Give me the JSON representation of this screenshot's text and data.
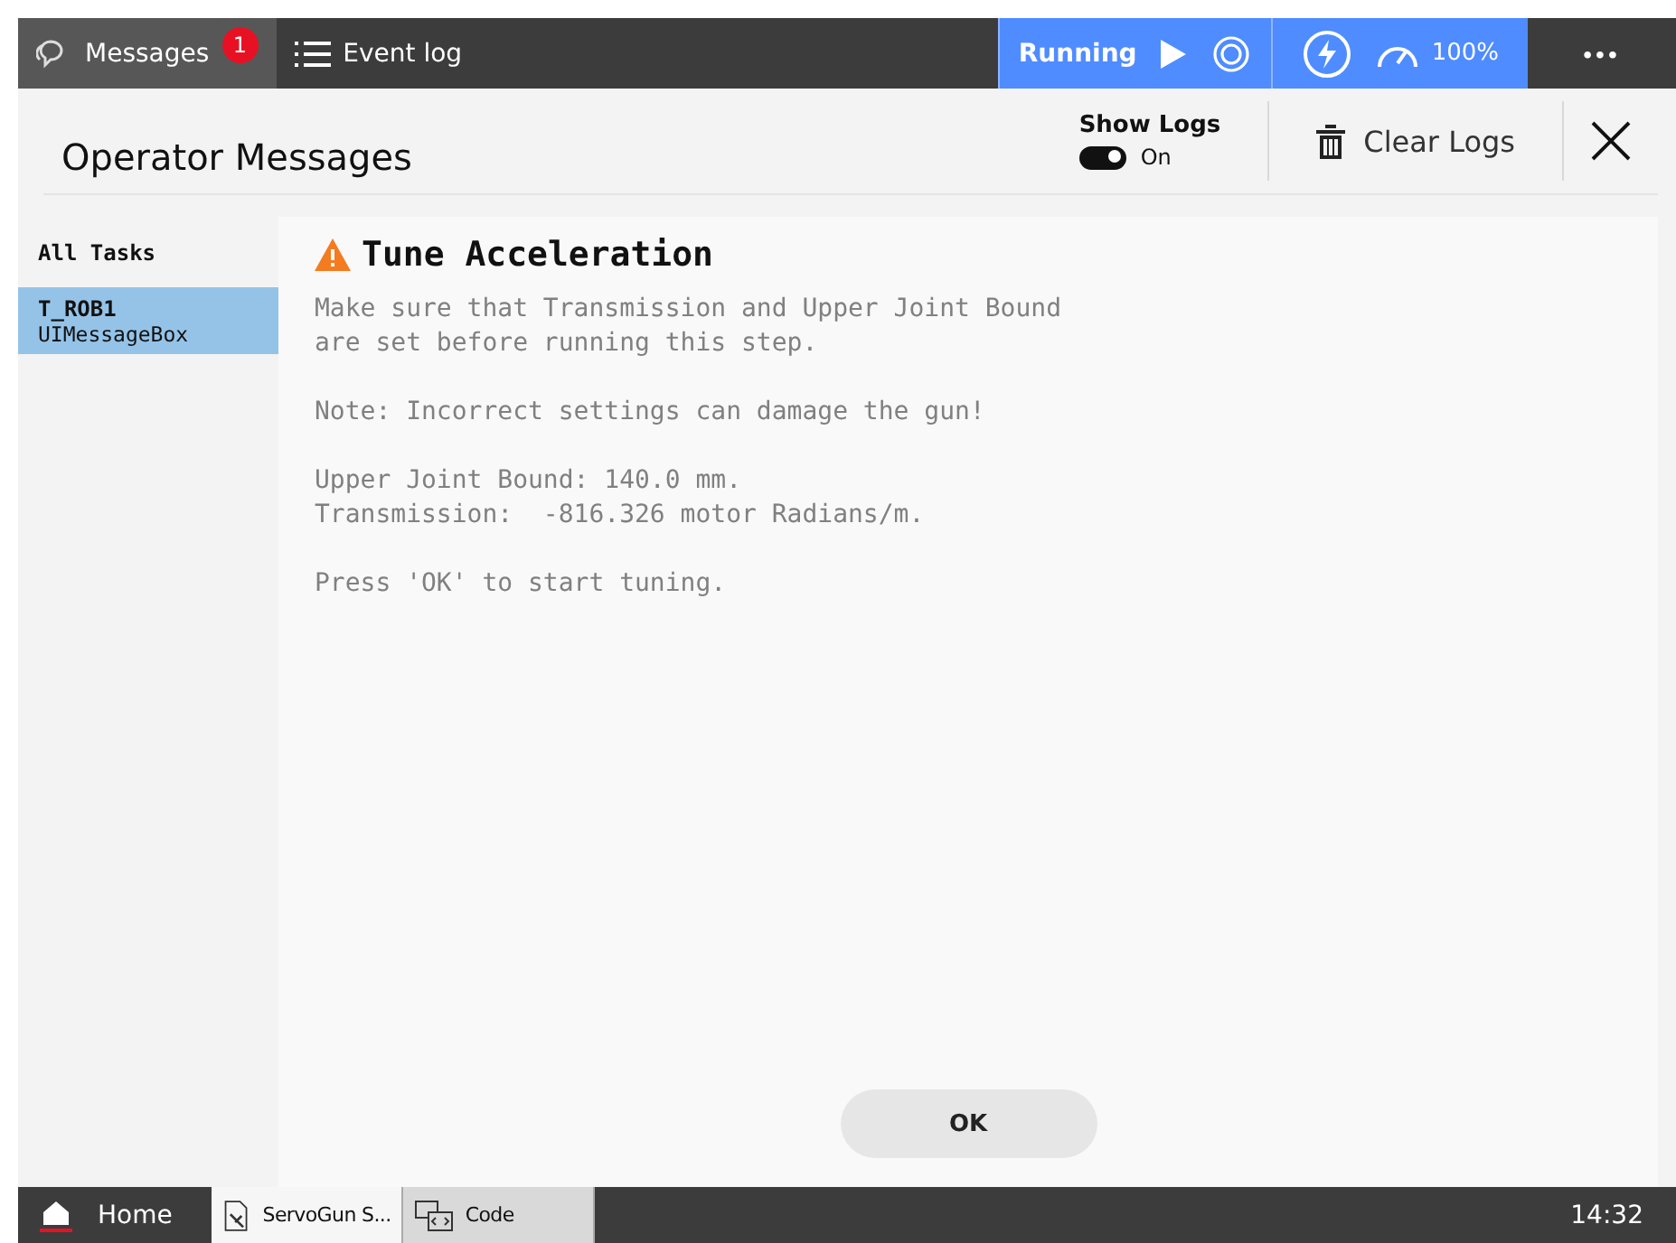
{
  "top_bar": {
    "tabs": [
      {
        "label": "Messages",
        "badge": "1",
        "selected": true,
        "kind": "chat"
      },
      {
        "label": "Event log",
        "selected": false,
        "kind": "list"
      }
    ],
    "status": {
      "state": "Running",
      "speed": "100%"
    },
    "more": "•••"
  },
  "header": {
    "title": "Operator Messages",
    "show_logs": {
      "label": "Show Logs",
      "on": true,
      "state_text": "On"
    },
    "clear_logs": "Clear Logs"
  },
  "sidebar": {
    "heading": "All Tasks",
    "items": [
      {
        "task": "T_ROB1",
        "module": "UIMessageBox",
        "selected": true
      }
    ]
  },
  "message": {
    "title": "Tune Acceleration",
    "paragraphs": [
      "Make sure that Transmission and Upper Joint Bound\nare set before running this step.",
      "Note: Incorrect settings can damage the gun!",
      "Upper Joint Bound: 140.0 mm.\nTransmission:  -816.326 motor Radians/m.",
      "Press 'OK' to start tuning."
    ],
    "button": "OK"
  },
  "taskbar": {
    "home": "Home",
    "apps": [
      {
        "label": "ServoGun S...",
        "selected": true,
        "kind": "servo"
      },
      {
        "label": "Code",
        "selected": false,
        "kind": "code"
      }
    ],
    "time": "14:32"
  }
}
